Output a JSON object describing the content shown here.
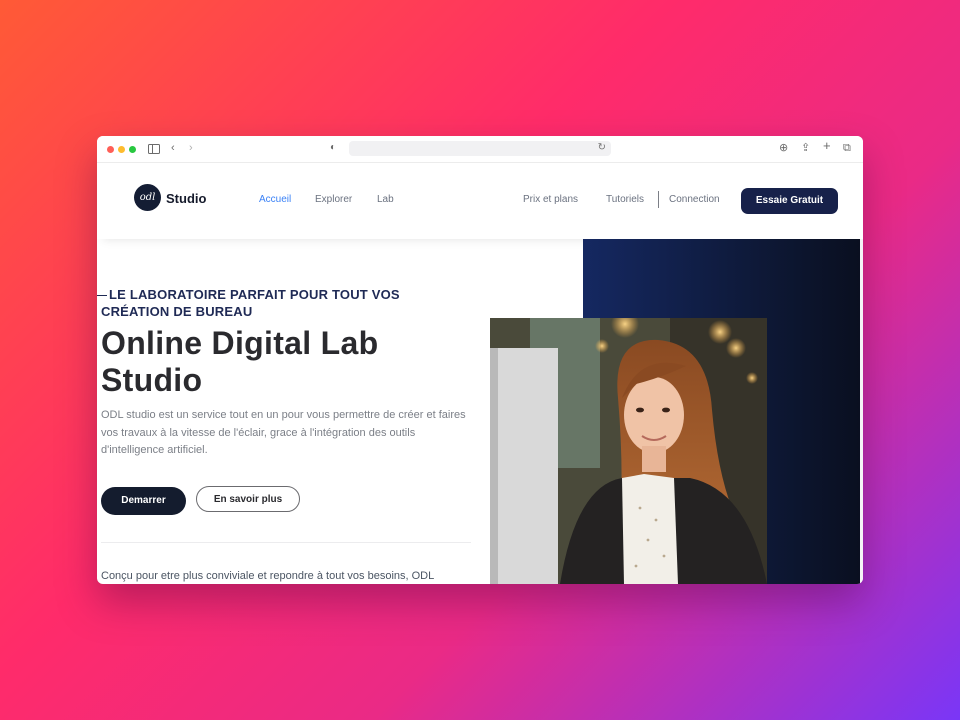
{
  "site": {
    "logo_mark": "odl",
    "logo_text": "Studio",
    "nav_left": [
      "Accueil",
      "Explorer",
      "Lab"
    ],
    "nav_right": [
      "Prix et plans",
      "Tutoriels",
      "Connection"
    ],
    "cta_label": "Essaie Gratuit",
    "accent_color": "#3b82f6",
    "brand_dark": "#17214a"
  },
  "hero": {
    "tagline_line1": "LE LABORATOIRE PARFAIT POUR TOUT VOS",
    "tagline_line2": "CRÉATION DE BUREAU",
    "title_line1": "Online Digital Lab",
    "title_line2": "Studio",
    "description": "ODL studio est un service tout en un pour vous permettre de créer et faires vos travaux à la vitesse de l'éclair, grace à l'intégration des outils d'intelligence artificiel.",
    "primary_button": "Demarrer",
    "secondary_button": "En savoir plus",
    "bottom_text": "Conçu pour etre plus conviviale et repondre à tout vos besoins, ODL"
  }
}
